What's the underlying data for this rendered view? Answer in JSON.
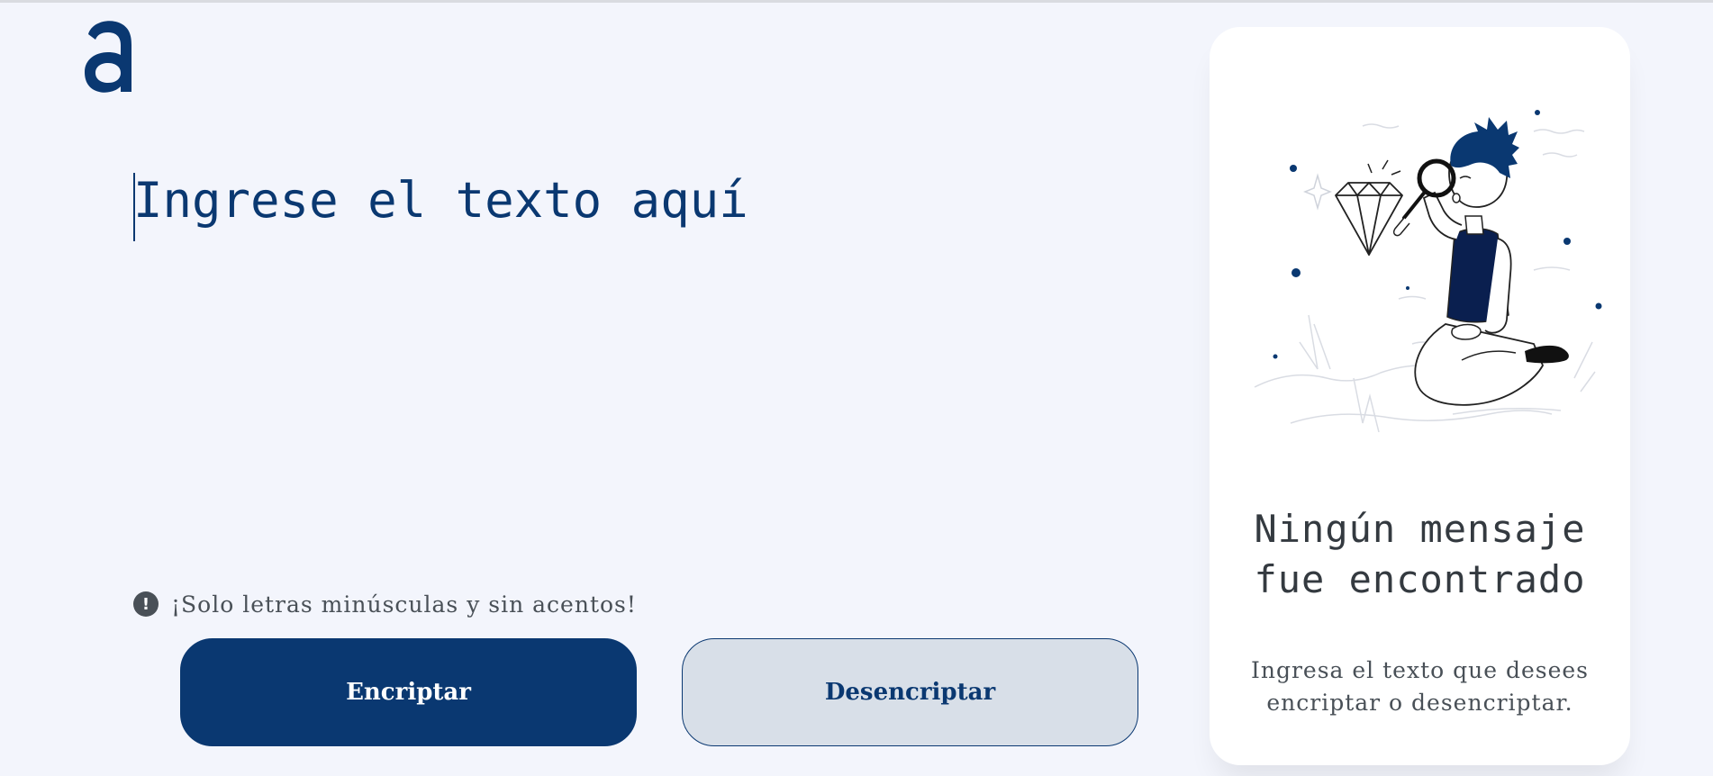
{
  "app": {
    "logo_letter": "a",
    "logo_icon": "alura-logo-icon"
  },
  "input": {
    "placeholder": "Ingrese el texto aquí",
    "value": ""
  },
  "hint": {
    "icon": "exclamation-circle-icon",
    "icon_glyph": "!",
    "text": "¡Solo letras minúsculas y sin acentos!"
  },
  "buttons": {
    "encrypt_label": "Encriptar",
    "decrypt_label": "Desencriptar"
  },
  "output_panel": {
    "illustration": "person-with-magnifying-glass-illustration",
    "title_line1": "Ningún mensaje",
    "title_line2": "fue encontrado",
    "subtitle": "Ingresa el texto que desees encriptar o desencriptar."
  },
  "colors": {
    "primary": "#0a3871",
    "background": "#f3f5fc",
    "secondary_button": "#d8dfe8",
    "text_gray": "#495057",
    "panel": "#ffffff"
  }
}
